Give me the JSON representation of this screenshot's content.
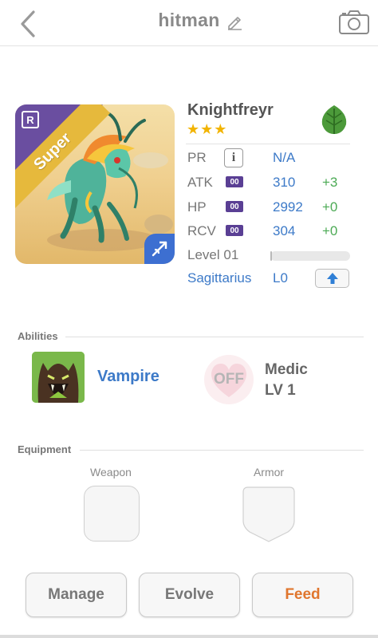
{
  "header": {
    "title": "hitman",
    "back_icon": "chevron-left-icon",
    "edit_icon": "pencil-icon",
    "camera_icon": "camera-icon"
  },
  "dragon": {
    "name": "Knightfreyr",
    "stars": "★★★",
    "star_count": 3,
    "rarity_letter": "R",
    "rank_ribbon": "Super",
    "element_icon": "leaf-icon",
    "class_icon": "archer-icon",
    "colors": {
      "ribbon": "#e6b93c",
      "ribbon_corner": "#6a4ea0",
      "class_badge": "#3d6fd1",
      "element": "#4c9a3a"
    }
  },
  "stats": {
    "pr": {
      "label": "PR",
      "value": "N/A"
    },
    "atk": {
      "label": "ATK",
      "pill": "00",
      "value": "310",
      "bonus": "+3"
    },
    "hp": {
      "label": "HP",
      "pill": "00",
      "value": "2992",
      "bonus": "+0"
    },
    "rcv": {
      "label": "RCV",
      "pill": "00",
      "value": "304",
      "bonus": "+0"
    },
    "level": {
      "label": "Level 01",
      "progress": 0.02
    },
    "zodiac": {
      "name": "Sagittarius",
      "level": "L0",
      "upgrade_icon": "arrow-up-icon"
    }
  },
  "abilities": {
    "title": "Abilities",
    "primary": {
      "name": "Vampire",
      "icon": "vampire-icon"
    },
    "secondary": {
      "status": "OFF",
      "name": "Medic",
      "level": "LV 1",
      "icon": "heart-icon"
    }
  },
  "equipment": {
    "title": "Equipment",
    "weapon_label": "Weapon",
    "armor_label": "Armor"
  },
  "actions": {
    "manage": "Manage",
    "evolve": "Evolve",
    "feed": "Feed"
  }
}
